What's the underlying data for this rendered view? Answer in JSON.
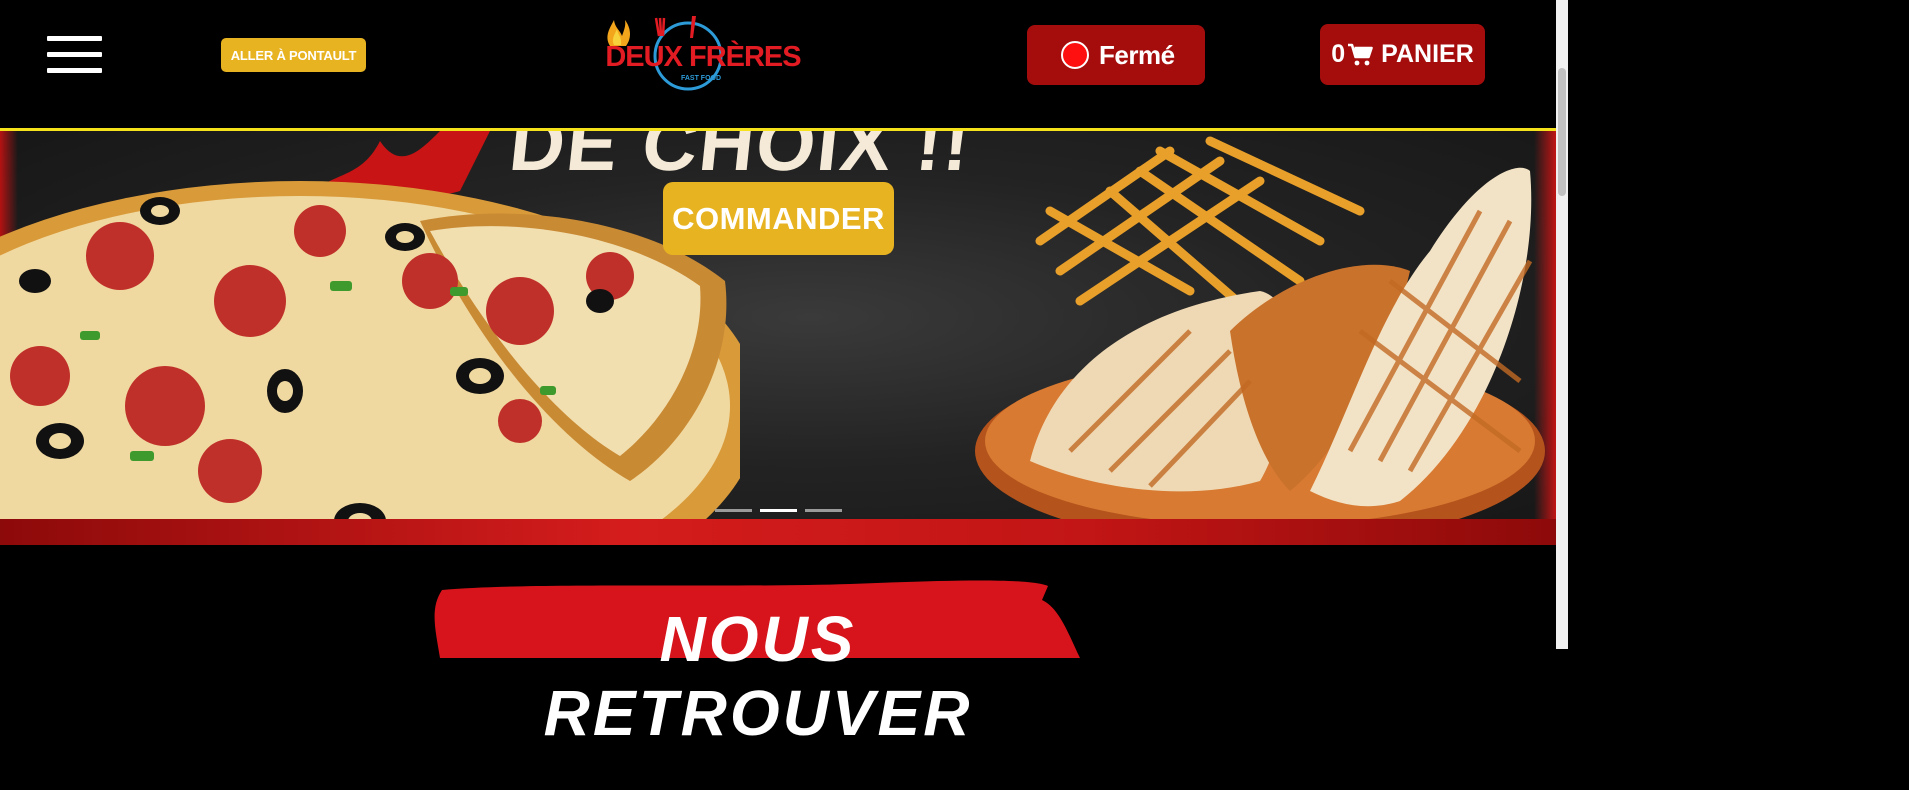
{
  "header": {
    "goto_button_label": "ALLER À PONTAULT",
    "logo_text": "DEUX FRÈRES",
    "logo_subtext": "FAST FOOD",
    "status_label": "Fermé",
    "status_color": "#ff1010",
    "cart_count": "0",
    "cart_label": "PANIER"
  },
  "hero": {
    "headline_fragment": "DE CHOIX !!",
    "order_button_label": "COMMANDER",
    "slides_total": 3,
    "active_slide": 2
  },
  "section": {
    "heading_fragment": "NOUS RETROUVER"
  },
  "colors": {
    "accent_yellow": "#e8b321",
    "brand_red": "#a50d0d",
    "header_border": "#f5e21a"
  }
}
